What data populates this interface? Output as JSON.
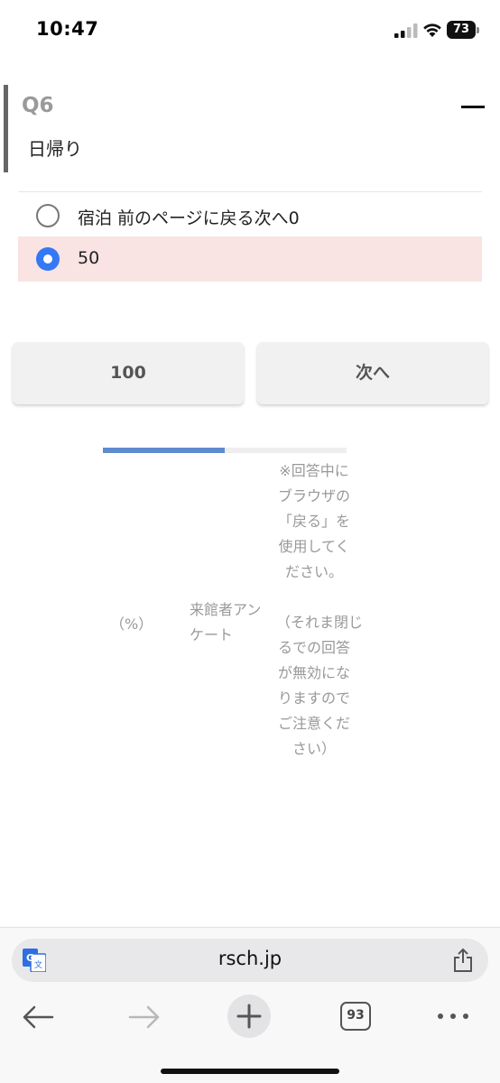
{
  "status_bar": {
    "time": "10:47",
    "battery": "73"
  },
  "question": {
    "number": "Q6",
    "text": "日帰り"
  },
  "options": [
    {
      "label": "宿泊 前のページに戻る次へ0",
      "selected": false
    },
    {
      "label": "50",
      "selected": true
    }
  ],
  "buttons": {
    "prev_label": "100",
    "next_label": "次へ"
  },
  "progress": {
    "percent": 50,
    "percent_label": "（%）"
  },
  "survey_name": "来館者アンケート",
  "notice": "※回答中にブラウザの「戻る」を使用してください。",
  "notice_tail": "（それま閉じるでの回答が無効になりますのでご注意ください）",
  "browser": {
    "url": "rsch.jp",
    "tab_count": "93"
  },
  "colors": {
    "accent": "#3478f6",
    "selected_bg": "#f9e3e3",
    "progress": "#5e8ccc"
  }
}
